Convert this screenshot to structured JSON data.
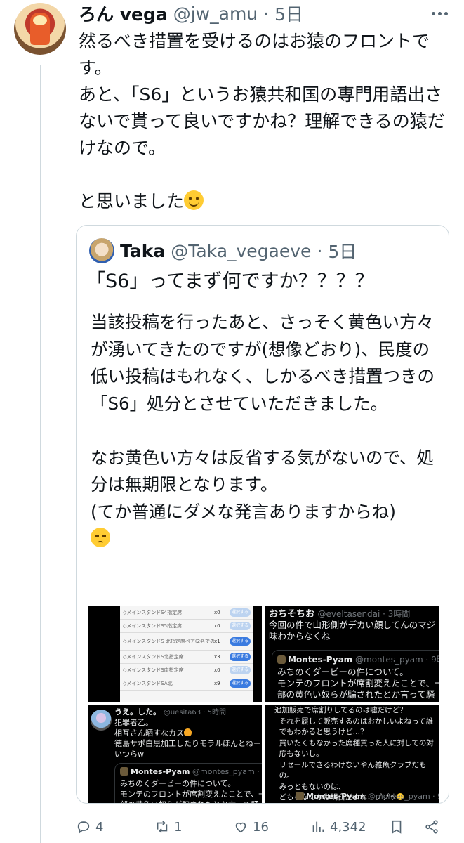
{
  "tweet": {
    "display_name": "ろん vega",
    "handle": "@jw_amu",
    "separator": "·",
    "time": "5日",
    "text": "然るべき措置を受けるのはお猿のフロントです。\nあと、「S6」というお猿共和国の専門用語出さないで貰って良いですかね？理解できるの猿だけなので。\n\nと思いました",
    "emoji": "smiling-face-icon"
  },
  "quote": {
    "display_name": "Taka",
    "handle": "@Taka_vegaeve",
    "separator": "·",
    "time": "5日",
    "question": "「S6」ってまず何ですか？？？？",
    "body": "当該投稿を行ったあと、さっそく黄色い方々が湧いてきたのですが(想像どおり)、民度の低い投稿はもれなく、しかるべき措置つきの「S6」処分とさせていただきました。\n\nなお黄色い方々は反省する気がないので、処分は無期限となります。\n(てか普通にダメな発言ありますからね)",
    "emoji": "pensive-face-icon"
  },
  "images": {
    "ticket_rows": [
      {
        "name": "◇メインスタンドS4指定席",
        "qty": "x0",
        "button": "選択する"
      },
      {
        "name": "◇メインスタンドS5指定席",
        "qty": "x0",
        "button": "選択する"
      },
      {
        "name": "◇メインスタンドS 北指定席ペア(2名での入場は2枚チケット購入必要)",
        "qty": "x1",
        "button": "選択する"
      },
      {
        "name": "◇メインスタンドS北指定席",
        "qty": "x3",
        "button": "選択する"
      },
      {
        "name": "◇メインスタンドS南指定席",
        "qty": "x0",
        "button": "選択する"
      },
      {
        "name": "◇メインスタンドSA北",
        "qty": "x9",
        "button": "選択する"
      }
    ],
    "post_a": {
      "name": "おちそちお",
      "meta": "@eveltasendai · 3時間",
      "text": "今回の件で山形側がデカい顔してんのマジ\n味わからなくね",
      "quoted_name": "Montes-Pyam",
      "quoted_meta": "@montes_pyam · 9時",
      "quoted_text": "みちのくダービーの件について。\nモンテのフロントが席割変えたことで、一\n部の黄色い奴らが騙されたとか言って騒"
    },
    "post_b": {
      "name": "うえ。した。",
      "meta": "@uesita63 · 5時間",
      "text_1": "犯罪者乙。",
      "text_2": "相互さん晒すなカス",
      "text_3": "徳島サポ白黒加工したりモラルほんとねーなこ\nいつらw",
      "quoted_name": "Montes-Pyam",
      "quoted_meta": "@montes_pyam · 9時間",
      "quoted_text": "みちのくダービーの件について。\nモンテのフロントが席割変えたことで、一\n部の黄色い奴らが騙されたとか言って騒"
    },
    "post_c": {
      "text": "追加販売で席割りしてるのは嘘だけど？\n  それを履して販売するのはおかしいよねって誰\n  でもわかると思うけど…？\n  買いたくもなかった席種買った人に対しての対\n  応もないし。\n  リセールできるわけないやん雑魚クラブだも\n  の。\n  みっともないのは、\n  どちらなのかは明白だよね…ププッ",
      "quoted_name": "Montes-Pyam",
      "quoted_meta": "@montes_pyam · 9時間"
    }
  },
  "actions": {
    "replies": "4",
    "retweets": "1",
    "likes": "16",
    "views": "4,342"
  },
  "icons": [
    "reply-icon",
    "retweet-icon",
    "heart-icon",
    "views-icon",
    "bookmark-icon",
    "share-icon",
    "more-icon"
  ]
}
